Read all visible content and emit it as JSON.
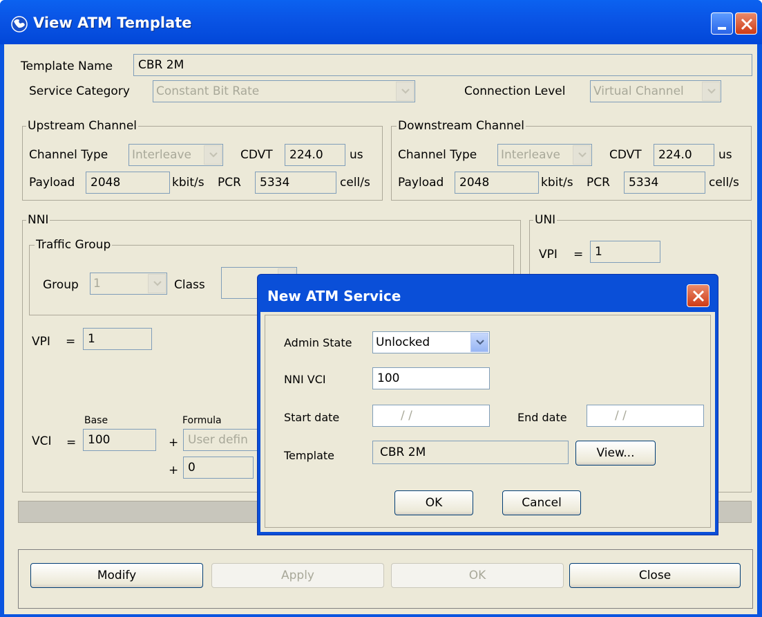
{
  "window": {
    "title": "View ATM Template",
    "icon": "globe-icon",
    "colors": {
      "titlebar": "#0a55e6",
      "client": "#ece9d8",
      "close": "#cf3b16"
    }
  },
  "template_name": {
    "label": "Template Name",
    "value": "CBR 2M"
  },
  "service_category": {
    "label": "Service Category",
    "value": "Constant Bit Rate"
  },
  "connection_level": {
    "label": "Connection Level",
    "value": "Virtual Channel"
  },
  "upstream": {
    "title": "Upstream Channel",
    "channel_type_label": "Channel Type",
    "channel_type": "Interleave",
    "cdvt_label": "CDVT",
    "cdvt": "224.0",
    "cdvt_unit": "us",
    "payload_label": "Payload",
    "payload": "2048",
    "payload_unit": "kbit/s",
    "pcr_label": "PCR",
    "pcr": "5334",
    "pcr_unit": "cell/s"
  },
  "downstream": {
    "title": "Downstream Channel",
    "channel_type_label": "Channel Type",
    "channel_type": "Interleave",
    "cdvt_label": "CDVT",
    "cdvt": "224.0",
    "cdvt_unit": "us",
    "payload_label": "Payload",
    "payload": "2048",
    "payload_unit": "kbit/s",
    "pcr_label": "PCR",
    "pcr": "5334",
    "pcr_unit": "cell/s"
  },
  "nni": {
    "title": "NNI",
    "traffic_group": {
      "title": "Traffic Group",
      "group_label": "Group",
      "group": "1",
      "class_label": "Class"
    },
    "vpi_label": "VPI",
    "eq": "=",
    "vpi": "1",
    "base_label": "Base",
    "formula_label": "Formula",
    "vci_label": "VCI",
    "vci_base": "100",
    "plus": "+",
    "formula": "User defin",
    "offset": "0"
  },
  "uni": {
    "title": "UNI",
    "vpi_label": "VPI",
    "eq": "=",
    "vpi": "1"
  },
  "footer": {
    "modify": "Modify",
    "apply": "Apply",
    "ok": "OK",
    "close": "Close"
  },
  "dialog": {
    "title": "New ATM Service",
    "admin_state_label": "Admin State",
    "admin_state": "Unlocked",
    "nni_vci_label": "NNI VCI",
    "nni_vci": "100",
    "start_date_label": "Start date",
    "start_date": "/     /",
    "end_date_label": "End date",
    "end_date": "/     /",
    "template_label": "Template",
    "template": "CBR 2M",
    "view_label": "View...",
    "ok_label": "OK",
    "cancel_label": "Cancel"
  }
}
